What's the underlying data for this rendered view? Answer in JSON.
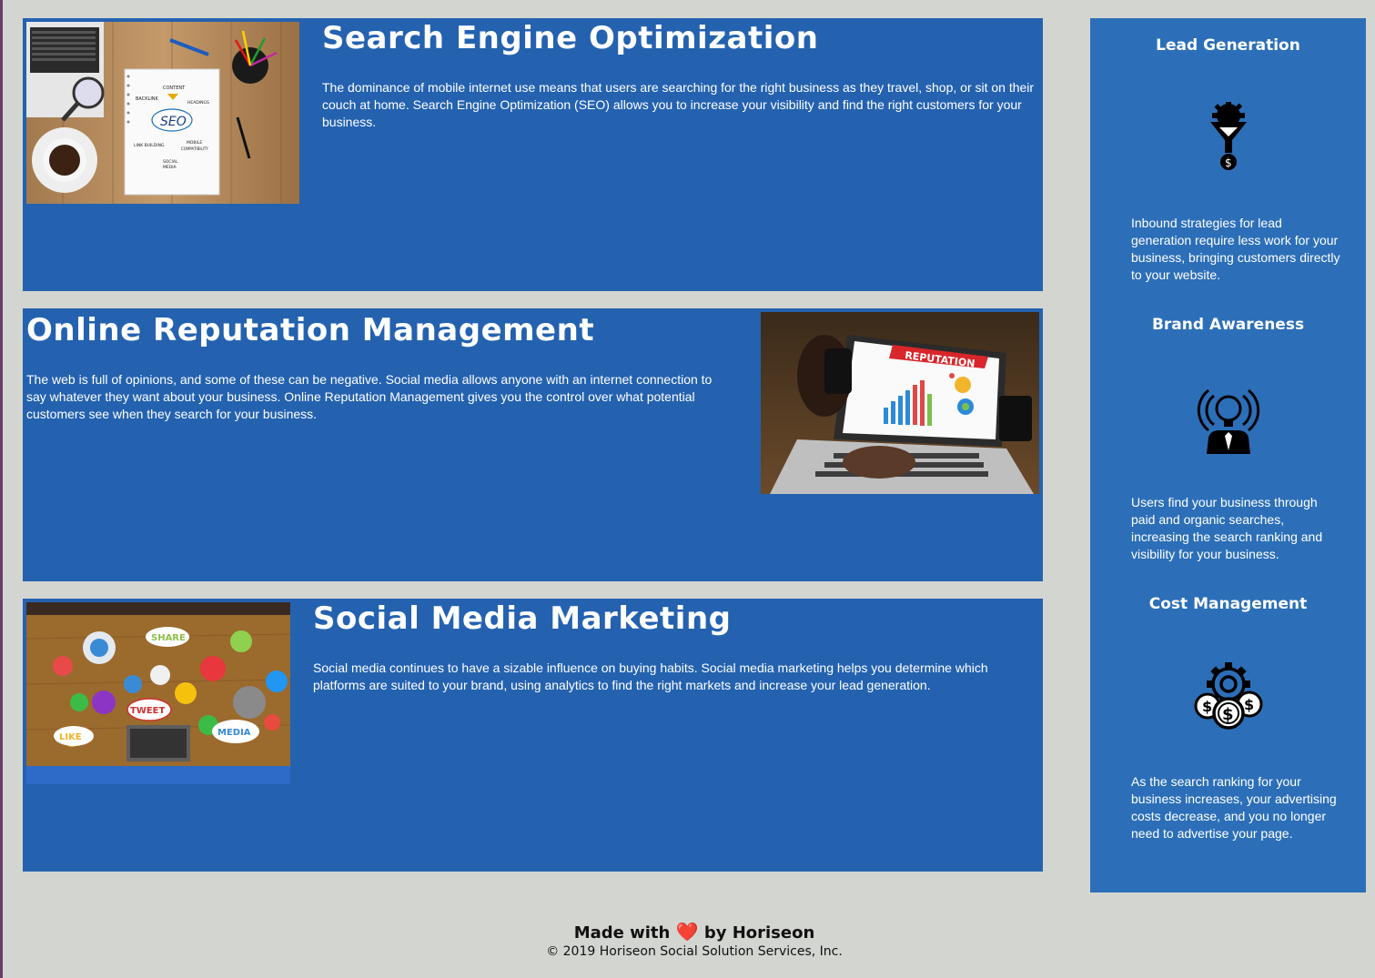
{
  "content": {
    "cards": [
      {
        "title": "Search Engine Optimization",
        "body": "The dominance of mobile internet use means that users are searching for the right business as they travel, shop, or sit on their couch at home. Search Engine Optimization (SEO) allows you to increase your visibility and find the right customers for your business.",
        "image": {
          "labels": [
            "CONTENT",
            "BACKLINK",
            "HEADINGS",
            "SEO",
            "LINK BUILDING",
            "MOBILE COMPATIBILITY",
            "SOCIAL MEDIA"
          ]
        }
      },
      {
        "title": "Online Reputation Management",
        "body": "The web is full of opinions, and some of these can be negative. Social media allows anyone with an internet connection to say whatever they want about your business. Online Reputation Management gives you the control over what potential customers see when they search for your business.",
        "image": {
          "labels": [
            "REPUTATION"
          ]
        }
      },
      {
        "title": "Social Media Marketing",
        "body": "Social media continues to have a sizable influence on buying habits. Social media marketing helps you determine which platforms are suited to your brand, using analytics to find the right markets and increase your lead generation.",
        "image": {
          "labels": [
            "SHARE",
            "TWEET",
            "LIKE",
            "MEDIA"
          ]
        }
      }
    ]
  },
  "sidebar": {
    "benefits": [
      {
        "title": "Lead Generation",
        "icon": "lead-generation-icon",
        "body": "Inbound strategies for lead generation require less work for your business, bringing customers directly to your website."
      },
      {
        "title": "Brand Awareness",
        "icon": "brand-awareness-icon",
        "body": "Users find your business through paid and organic searches, increasing the search ranking and visibility for your business."
      },
      {
        "title": "Cost Management",
        "icon": "cost-management-icon",
        "body": "As the search ranking for your business increases, your advertising costs decrease, and you no longer need to advertise your page."
      }
    ]
  },
  "footer": {
    "made_prefix": "Made with",
    "made_suffix": "by Horiseon",
    "heart": "❤️",
    "copyright": "© 2019 Horiseon Social Solution Services, Inc."
  },
  "colors": {
    "page_bg": "#d3d5d1",
    "card_bg": "#2462b0",
    "sidebar_bg": "#2c6fb8",
    "text": "#ffffff"
  }
}
